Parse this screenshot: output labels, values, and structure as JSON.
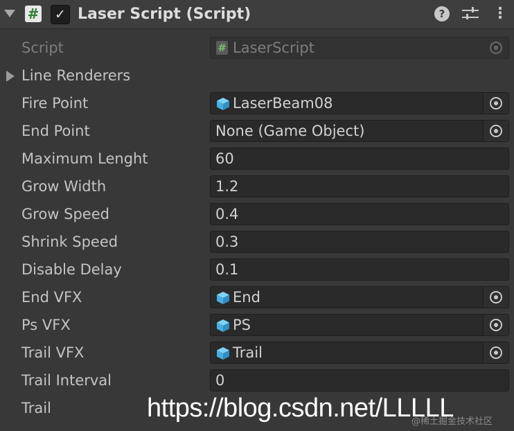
{
  "header": {
    "script_icon_glyph": "#",
    "checkbox_glyph": "✓",
    "title": "Laser Script (Script)",
    "help_glyph": "?",
    "menu_glyph": "⋮",
    "checkbox_checked": true
  },
  "rows": {
    "script": {
      "label": "Script",
      "value": "LaserScript",
      "icon": "script-hash-icon"
    },
    "line_renderers": {
      "label": "Line Renderers"
    },
    "fire_point": {
      "label": "Fire Point",
      "value": "LaserBeam08",
      "icon": "gameobject-cube-icon"
    },
    "end_point": {
      "label": "End Point",
      "value": "None (Game Object)"
    },
    "maximum_lenght": {
      "label": "Maximum Lenght",
      "value": "60"
    },
    "grow_width": {
      "label": "Grow Width",
      "value": "1.2"
    },
    "grow_speed": {
      "label": "Grow Speed",
      "value": "0.4"
    },
    "shrink_speed": {
      "label": "Shrink Speed",
      "value": "0.3"
    },
    "disable_delay": {
      "label": "Disable Delay",
      "value": "0.1"
    },
    "end_vfx": {
      "label": "End VFX",
      "value": "End",
      "icon": "gameobject-cube-icon"
    },
    "ps_vfx": {
      "label": "Ps VFX",
      "value": "PS",
      "icon": "gameobject-cube-icon"
    },
    "trail_vfx": {
      "label": "Trail VFX",
      "value": "Trail",
      "icon": "gameobject-cube-icon"
    },
    "trail_interval": {
      "label": "Trail Interval",
      "value": "0"
    },
    "trail": {
      "label": "Trail"
    }
  },
  "watermark": {
    "url": "https://blog.csdn.net/LLLLL",
    "small": "@稀土掘金技术社区"
  },
  "colors": {
    "background": "#383838",
    "field": "#2a2a2a",
    "cube_icon": "#5bc0f0"
  }
}
